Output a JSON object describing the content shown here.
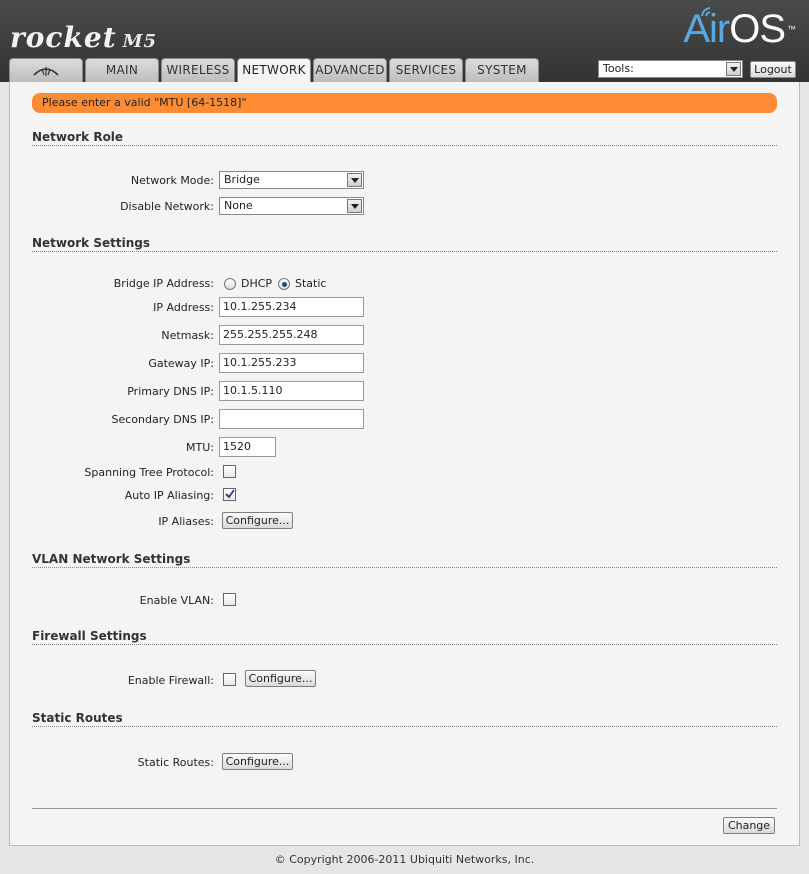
{
  "header": {
    "brand": "rocket",
    "model": "M5",
    "logo_air": "Air",
    "logo_os": "OS",
    "trademark": "™",
    "colors": {
      "accent": "#5aa8e0",
      "alert": "#ff8c35"
    }
  },
  "tabs": [
    {
      "label": "",
      "icon": "ubiquiti-logo-icon"
    },
    {
      "label": "MAIN"
    },
    {
      "label": "WIRELESS"
    },
    {
      "label": "NETWORK",
      "active": true
    },
    {
      "label": "ADVANCED"
    },
    {
      "label": "SERVICES"
    },
    {
      "label": "SYSTEM"
    }
  ],
  "tools": {
    "selected": "Tools:"
  },
  "logout_label": "Logout",
  "alert": "Please enter a valid \"MTU [64-1518]\"",
  "sections": {
    "network_role": "Network Role",
    "network_settings": "Network Settings",
    "vlan": "VLAN Network Settings",
    "firewall": "Firewall Settings",
    "static_routes": "Static Routes"
  },
  "fields": {
    "network_mode": {
      "label": "Network Mode:",
      "value": "Bridge"
    },
    "disable_network": {
      "label": "Disable Network:",
      "value": "None"
    },
    "bridge_ip": {
      "label": "Bridge IP Address:",
      "opt_dhcp": "DHCP",
      "opt_static": "Static",
      "selected": "Static"
    },
    "ip_address": {
      "label": "IP Address:",
      "value": "10.1.255.234"
    },
    "netmask": {
      "label": "Netmask:",
      "value": "255.255.255.248"
    },
    "gateway": {
      "label": "Gateway IP:",
      "value": "10.1.255.233"
    },
    "primary_dns": {
      "label": "Primary DNS IP:",
      "value": "10.1.5.110"
    },
    "secondary_dns": {
      "label": "Secondary DNS IP:",
      "value": ""
    },
    "mtu": {
      "label": "MTU:",
      "value": "1520"
    },
    "stp": {
      "label": "Spanning Tree Protocol:",
      "checked": false
    },
    "auto_ip": {
      "label": "Auto IP Aliasing:",
      "checked": true
    },
    "ip_aliases": {
      "label": "IP Aliases:",
      "button": "Configure..."
    },
    "enable_vlan": {
      "label": "Enable VLAN:",
      "checked": false
    },
    "enable_firewall": {
      "label": "Enable Firewall:",
      "checked": false,
      "button": "Configure..."
    },
    "static_routes": {
      "label": "Static Routes:",
      "button": "Configure..."
    }
  },
  "change_label": "Change",
  "copyright": "© Copyright 2006-2011 Ubiquiti Networks, Inc."
}
